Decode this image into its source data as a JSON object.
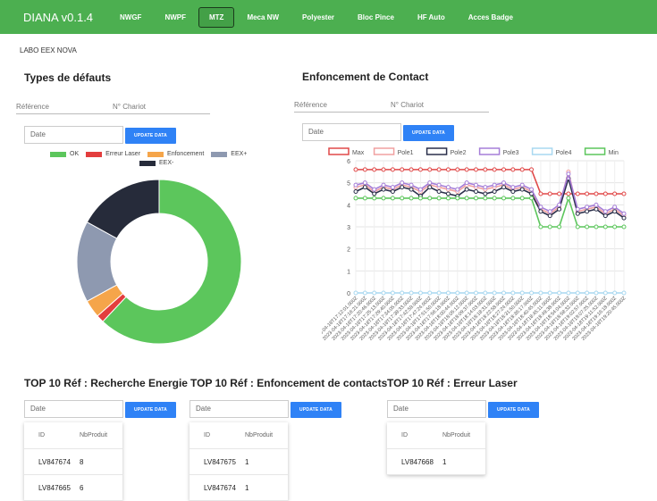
{
  "app": {
    "title": "DIANA v0.1.4"
  },
  "nav": {
    "items": [
      {
        "label": "NWGF",
        "active": false
      },
      {
        "label": "NWPF",
        "active": false
      },
      {
        "label": "MTZ",
        "active": true
      },
      {
        "label": "Meca NW",
        "active": false
      },
      {
        "label": "Polyester",
        "active": false
      },
      {
        "label": "Bloc Pince",
        "active": false
      },
      {
        "label": "HF Auto",
        "active": false
      },
      {
        "label": "Acces Badge",
        "active": false
      }
    ]
  },
  "lab_label": "LABO EEX NOVA",
  "defects": {
    "title": "Types de défauts",
    "reference_label": "Référence",
    "chariot_label": "N° Chariot",
    "date_placeholder": "Date",
    "update_label": "UPDATE DATA"
  },
  "contact": {
    "title": "Enfoncement de Contact",
    "reference_label": "Référence",
    "chariot_label": "N° Chariot",
    "date_placeholder": "Date",
    "update_label": "UPDATE DATA"
  },
  "colors": {
    "ok": "#5cc65c",
    "laser": "#e33d3d",
    "enfoncement": "#f5a54a",
    "eexplus": "#8e99b0",
    "eexminus": "#262b3a"
  },
  "chart_data": [
    {
      "type": "pie",
      "categories": [
        "OK",
        "Erreur Laser",
        "Enfoncement",
        "EEX+",
        "EEX-"
      ],
      "values": [
        62,
        1.5,
        3.5,
        16,
        17
      ],
      "legend_position": "top"
    },
    {
      "type": "line",
      "legend_position": "top",
      "ylim": [
        0,
        6
      ],
      "yticks": [
        0,
        1,
        2,
        3,
        4,
        5,
        6
      ],
      "grid": true,
      "xticks": [
        "2023-04-18T17:12:01.000Z",
        "2023-04-18T17:16:21.000Z",
        "2023-04-18T17:20:46.000Z",
        "2023-04-18T17:25:13.000Z",
        "2023-04-18T17:29:40.000Z",
        "2023-04-18T17:34:05.000Z",
        "2023-04-18T17:38:33.000Z",
        "2023-04-18T17:42:59.000Z",
        "2023-04-18T17:47:24.000Z",
        "2023-04-18T17:51:50.000Z",
        "2023-04-18T17:56:18.000Z",
        "2023-04-18T18:00:44.000Z",
        "2023-04-18T18:05:12.000Z",
        "2023-04-18T18:09:37.000Z",
        "2023-04-18T18:14:03.000Z",
        "2023-04-18T18:18:31.000Z",
        "2023-04-18T18:22:58.000Z",
        "2023-04-18T18:27:24.000Z",
        "2023-04-18T18:31:50.000Z",
        "2023-04-18T18:36:17.000Z",
        "2023-04-18T18:40:45.000Z",
        "2023-04-18T18:45:11.000Z",
        "2023-04-18T18:49:38.000Z",
        "2023-04-18T18:54:04.000Z",
        "2023-04-18T18:58:32.000Z",
        "2023-04-18T19:02:57.000Z",
        "2023-04-18T19:07:25.000Z",
        "2023-04-18T19:11:52.000Z",
        "2023-04-18T19:16:18.000Z",
        "2023-04-18T19:20:45.000Z"
      ],
      "series": [
        {
          "name": "Max",
          "color": "#e04848",
          "values": [
            5.6,
            5.6,
            5.6,
            5.6,
            5.6,
            5.6,
            5.6,
            5.6,
            5.6,
            5.6,
            5.6,
            5.6,
            5.6,
            5.6,
            5.6,
            5.6,
            5.6,
            5.6,
            5.6,
            5.6,
            4.5,
            4.5,
            4.5,
            4.5,
            4.5,
            4.5,
            4.5,
            4.5,
            4.5,
            4.5
          ]
        },
        {
          "name": "Pole1",
          "color": "#f0a0a0",
          "values": [
            4.8,
            4.9,
            4.6,
            4.8,
            4.7,
            4.9,
            4.8,
            4.6,
            4.9,
            4.8,
            4.7,
            4.6,
            4.9,
            4.8,
            4.7,
            4.8,
            4.9,
            4.7,
            4.8,
            4.6,
            3.8,
            3.6,
            3.9,
            5.5,
            3.7,
            3.8,
            3.9,
            3.6,
            3.8,
            3.5
          ]
        },
        {
          "name": "Pole2",
          "color": "#2a2f4a",
          "values": [
            4.6,
            4.8,
            4.5,
            4.7,
            4.6,
            4.8,
            4.7,
            4.4,
            4.8,
            4.6,
            4.5,
            4.4,
            4.7,
            4.6,
            4.5,
            4.6,
            4.8,
            4.6,
            4.7,
            4.5,
            3.7,
            3.5,
            3.8,
            5.2,
            3.6,
            3.7,
            3.8,
            3.5,
            3.7,
            3.4
          ]
        },
        {
          "name": "Pole3",
          "color": "#a57ed8",
          "values": [
            4.9,
            5.0,
            4.7,
            4.9,
            4.8,
            5.0,
            4.9,
            4.7,
            5.0,
            4.9,
            4.8,
            4.7,
            5.0,
            4.9,
            4.8,
            4.9,
            5.0,
            4.8,
            4.9,
            4.7,
            3.9,
            3.7,
            4.0,
            5.4,
            3.8,
            3.9,
            4.0,
            3.7,
            3.9,
            3.6
          ]
        },
        {
          "name": "Pole4",
          "color": "#a8d8f0",
          "values": [
            0,
            0,
            0,
            0,
            0,
            0,
            0,
            0,
            0,
            0,
            0,
            0,
            0,
            0,
            0,
            0,
            0,
            0,
            0,
            0,
            0,
            0,
            0,
            0,
            0,
            0,
            0,
            0,
            0,
            0
          ]
        },
        {
          "name": "Min",
          "color": "#5cc65c",
          "values": [
            4.3,
            4.3,
            4.3,
            4.3,
            4.3,
            4.3,
            4.3,
            4.3,
            4.3,
            4.3,
            4.3,
            4.3,
            4.3,
            4.3,
            4.3,
            4.3,
            4.3,
            4.3,
            4.3,
            4.3,
            3.0,
            3.0,
            3.0,
            4.3,
            3.0,
            3.0,
            3.0,
            3.0,
            3.0,
            3.0
          ]
        }
      ]
    }
  ],
  "tops": [
    {
      "title": "TOP 10 Réf : Recherche Energie",
      "date_placeholder": "Date",
      "update_label": "UPDATE DATA",
      "columns": [
        "ID",
        "NbProduit"
      ],
      "rows": [
        [
          "LV847674",
          "8"
        ],
        [
          "LV847665",
          "6"
        ]
      ]
    },
    {
      "title": "TOP 10 Réf : Enfoncement de contacts",
      "date_placeholder": "Date",
      "update_label": "UPDATE DATA",
      "columns": [
        "ID",
        "NbProduit"
      ],
      "rows": [
        [
          "LV847675",
          "1"
        ],
        [
          "LV847674",
          "1"
        ]
      ]
    },
    {
      "title": "TOP 10 Réf : Erreur Laser",
      "date_placeholder": "Date",
      "update_label": "UPDATE DATA",
      "columns": [
        "ID",
        "NbProduit"
      ],
      "rows": [
        [
          "LV847668",
          "1"
        ]
      ]
    }
  ]
}
